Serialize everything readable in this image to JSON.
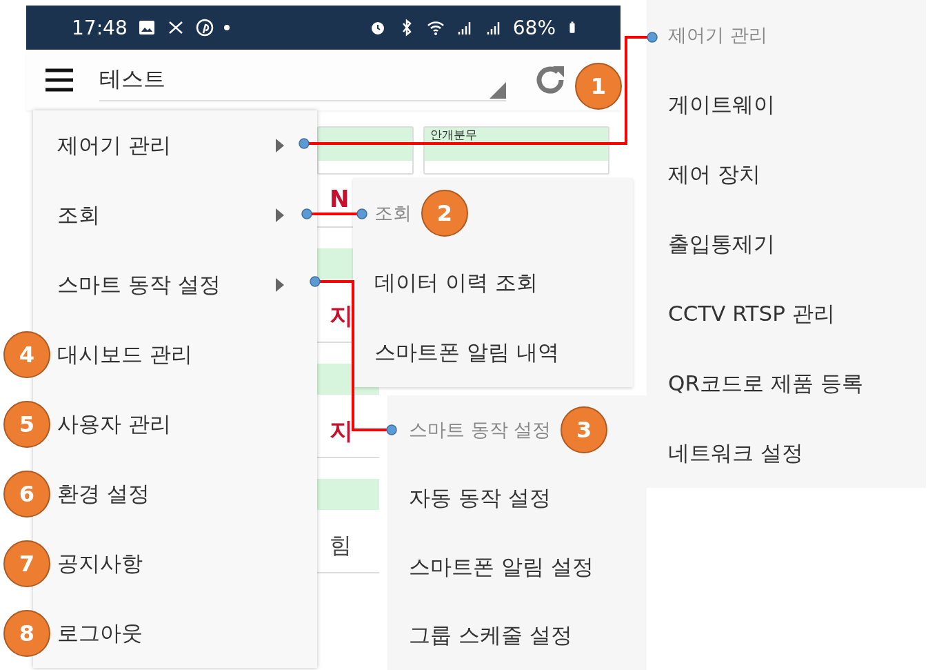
{
  "status_bar": {
    "time": "17:48",
    "battery": "68%"
  },
  "app_bar": {
    "title": "테스트",
    "callout": "1"
  },
  "background": {
    "header_cells": [
      "",
      "안개분무"
    ],
    "fragments": [
      {
        "kind": "alert",
        "text": "N"
      },
      {
        "kind": "green"
      },
      {
        "kind": "alert",
        "text": "지"
      },
      {
        "kind": "green"
      },
      {
        "kind": "alert",
        "text": "지"
      },
      {
        "kind": "green"
      },
      {
        "kind": "text",
        "text": "힘"
      }
    ]
  },
  "main_menu": [
    {
      "label": "제어기 관리",
      "has_submenu": true
    },
    {
      "label": "조회",
      "has_submenu": true
    },
    {
      "label": "스마트 동작 설정",
      "has_submenu": true
    },
    {
      "label": "대시보드 관리",
      "has_submenu": false,
      "callout": "4"
    },
    {
      "label": "사용자 관리",
      "has_submenu": false,
      "callout": "5"
    },
    {
      "label": "환경 설정",
      "has_submenu": false,
      "callout": "6"
    },
    {
      "label": "공지사항",
      "has_submenu": false,
      "callout": "7"
    },
    {
      "label": "로그아웃",
      "has_submenu": false,
      "callout": "8"
    }
  ],
  "submenus": [
    {
      "header": "제어기 관리",
      "items": [
        "게이트웨이",
        "제어 장치",
        "출입통제기",
        "CCTV RTSP 관리",
        "QR코드로 제품 등록",
        "네트워크 설정"
      ]
    },
    {
      "header": "조회",
      "callout": "2",
      "items": [
        "데이터 이력 조회",
        "스마트폰 알림 내역"
      ]
    },
    {
      "header": "스마트 동작 설정",
      "callout": "3",
      "items": [
        "자동 동작 설정",
        "스마트폰 알림 설정",
        "그룹 스케줄 설정"
      ]
    }
  ]
}
